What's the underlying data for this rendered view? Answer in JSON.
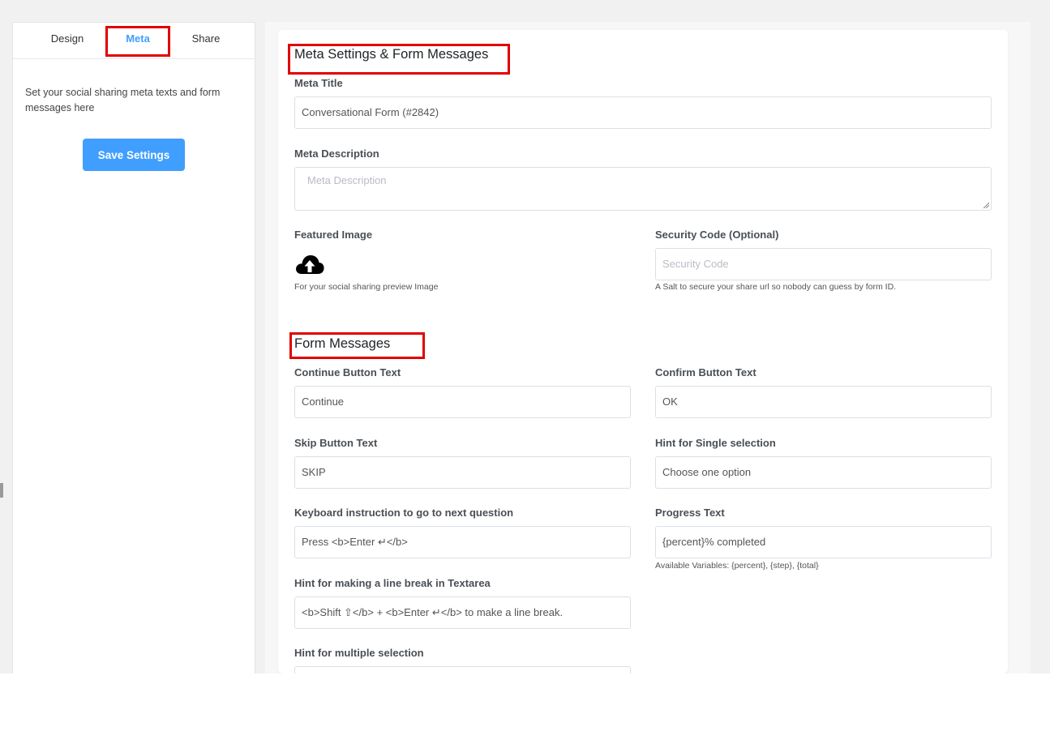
{
  "sidebar": {
    "tabs": [
      {
        "label": "Design"
      },
      {
        "label": "Meta"
      },
      {
        "label": "Share"
      }
    ],
    "description": "Set your social sharing meta texts and form messages here",
    "save_label": "Save Settings"
  },
  "meta_section": {
    "title": "Meta Settings & Form Messages",
    "meta_title_label": "Meta Title",
    "meta_title_value": "Conversational Form (#2842)",
    "meta_description_label": "Meta Description",
    "meta_description_placeholder": "Meta Description",
    "featured_image_label": "Featured Image",
    "featured_image_help": "For your social sharing preview Image",
    "security_code_label": "Security Code (Optional)",
    "security_code_placeholder": "Security Code",
    "security_code_help": "A Salt to secure your share url so nobody can guess by form ID."
  },
  "messages_section": {
    "title": "Form Messages",
    "continue_label": "Continue Button Text",
    "continue_value": "Continue",
    "confirm_label": "Confirm Button Text",
    "confirm_value": "OK",
    "skip_label": "Skip Button Text",
    "skip_value": "SKIP",
    "single_hint_label": "Hint for Single selection",
    "single_hint_value": "Choose one option",
    "keyboard_label": "Keyboard instruction to go to next question",
    "keyboard_value": "Press <b>Enter ↵</b>",
    "progress_label": "Progress Text",
    "progress_value": "{percent}% completed",
    "progress_help": "Available Variables: {percent}, {step}, {total}",
    "line_break_label": "Hint for making a line break in Textarea",
    "line_break_value": "<b>Shift ⇧</b> + <b>Enter ↵</b> to make a line break.",
    "multiple_label": "Hint for multiple selection"
  },
  "colors": {
    "accent": "#409eff",
    "highlight": "#e10000"
  }
}
